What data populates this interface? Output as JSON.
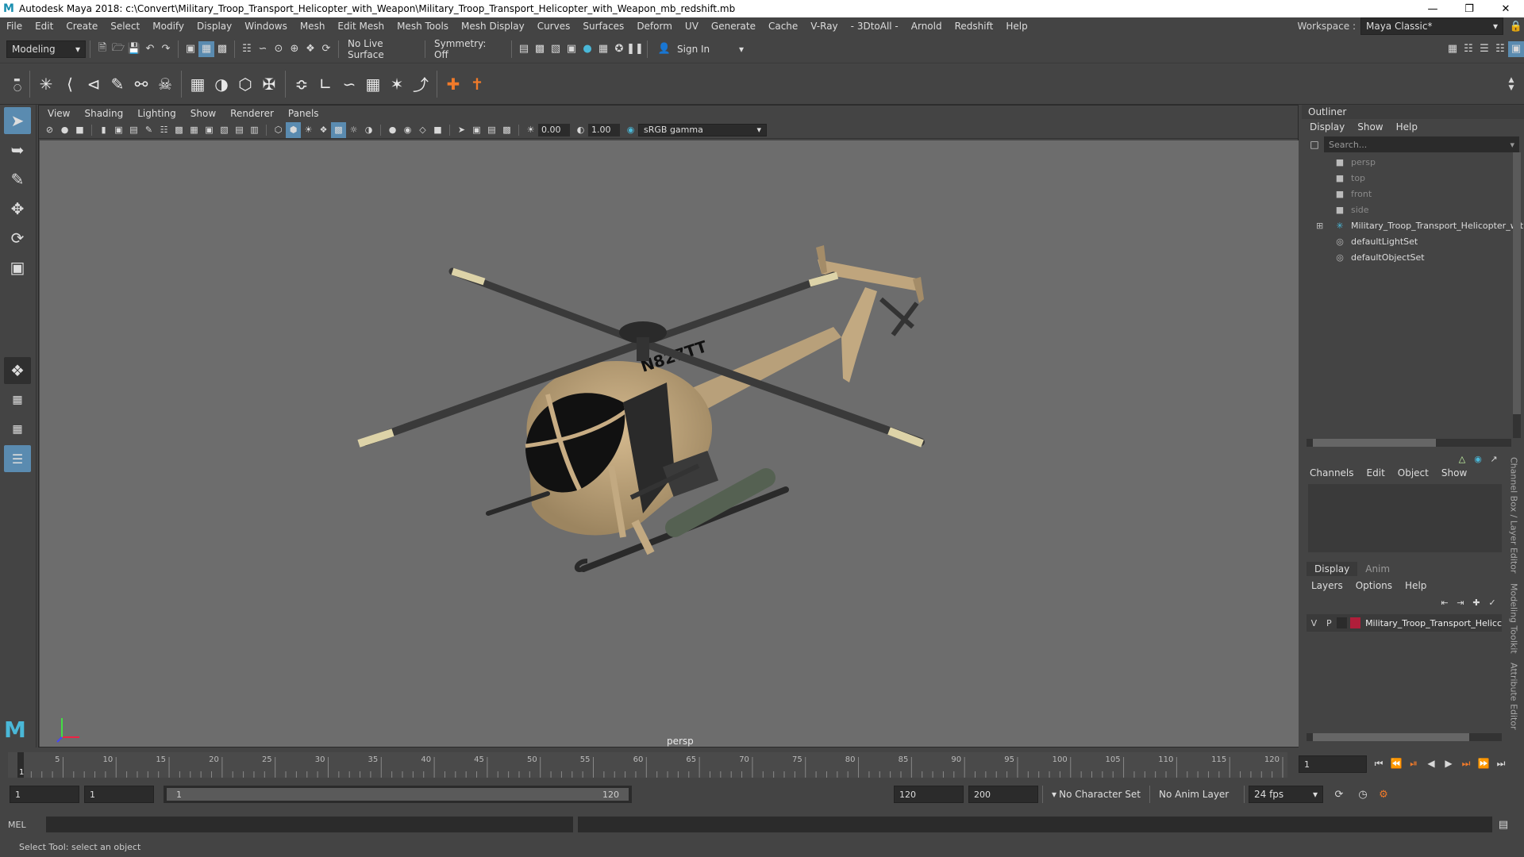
{
  "window": {
    "title": "Autodesk Maya 2018: c:\\Convert\\Military_Troop_Transport_Helicopter_with_Weapon\\Military_Troop_Transport_Helicopter_with_Weapon_mb_redshift.mb",
    "logo_letter": "M"
  },
  "menubar": {
    "items": [
      "File",
      "Edit",
      "Create",
      "Select",
      "Modify",
      "Display",
      "Windows",
      "Mesh",
      "Edit Mesh",
      "Mesh Tools",
      "Mesh Display",
      "Curves",
      "Surfaces",
      "Deform",
      "UV",
      "Generate",
      "Cache",
      "V-Ray",
      "- 3DtoAll -",
      "Arnold",
      "Redshift",
      "Help"
    ],
    "workspace_label": "Workspace :",
    "workspace_value": "Maya Classic*"
  },
  "statusbar": {
    "mode": "Modeling",
    "live_surface": "No Live Surface",
    "symmetry": "Symmetry: Off",
    "sign_in": "Sign In"
  },
  "viewport": {
    "menus": [
      "View",
      "Shading",
      "Lighting",
      "Show",
      "Renderer",
      "Panels"
    ],
    "exposure": "0.00",
    "gamma": "1.00",
    "color_space": "sRGB gamma",
    "camera_label": "persp",
    "tail_number": "N827TT"
  },
  "outliner": {
    "title": "Outliner",
    "menus": [
      "Display",
      "Show",
      "Help"
    ],
    "search_placeholder": "Search...",
    "items": [
      {
        "label": "persp",
        "type": "camera"
      },
      {
        "label": "top",
        "type": "camera"
      },
      {
        "label": "front",
        "type": "camera"
      },
      {
        "label": "side",
        "type": "camera"
      },
      {
        "label": "Military_Troop_Transport_Helicopter_wit",
        "type": "group"
      },
      {
        "label": "defaultLightSet",
        "type": "set"
      },
      {
        "label": "defaultObjectSet",
        "type": "set"
      }
    ]
  },
  "channelbox": {
    "menus": [
      "Channels",
      "Edit",
      "Object",
      "Show"
    ]
  },
  "layereditor": {
    "tabs": [
      "Display",
      "Anim"
    ],
    "menus": [
      "Layers",
      "Options",
      "Help"
    ],
    "layer": {
      "v": "V",
      "p": "P",
      "name": "Military_Troop_Transport_Helicc",
      "color": "#b01e3a"
    }
  },
  "side_tabs": [
    "Channel Box / Layer Editor",
    "Modeling Toolkit",
    "Attribute Editor"
  ],
  "timeline": {
    "ticks": [
      "5",
      "10",
      "15",
      "20",
      "25",
      "30",
      "35",
      "40",
      "45",
      "50",
      "55",
      "60",
      "65",
      "70",
      "75",
      "80",
      "85",
      "90",
      "95",
      "100",
      "105",
      "110",
      "115",
      "120"
    ],
    "start_tick": "1",
    "current_frame": "1"
  },
  "range": {
    "start": "1",
    "playback_start": "1",
    "slider_start": "1",
    "slider_end": "120",
    "playback_end": "120",
    "end": "200",
    "character_set": "No Character Set",
    "anim_layer": "No Anim Layer",
    "fps": "24 fps"
  },
  "command": {
    "lang": "MEL"
  },
  "status": {
    "help_text": "Select Tool: select an object"
  }
}
